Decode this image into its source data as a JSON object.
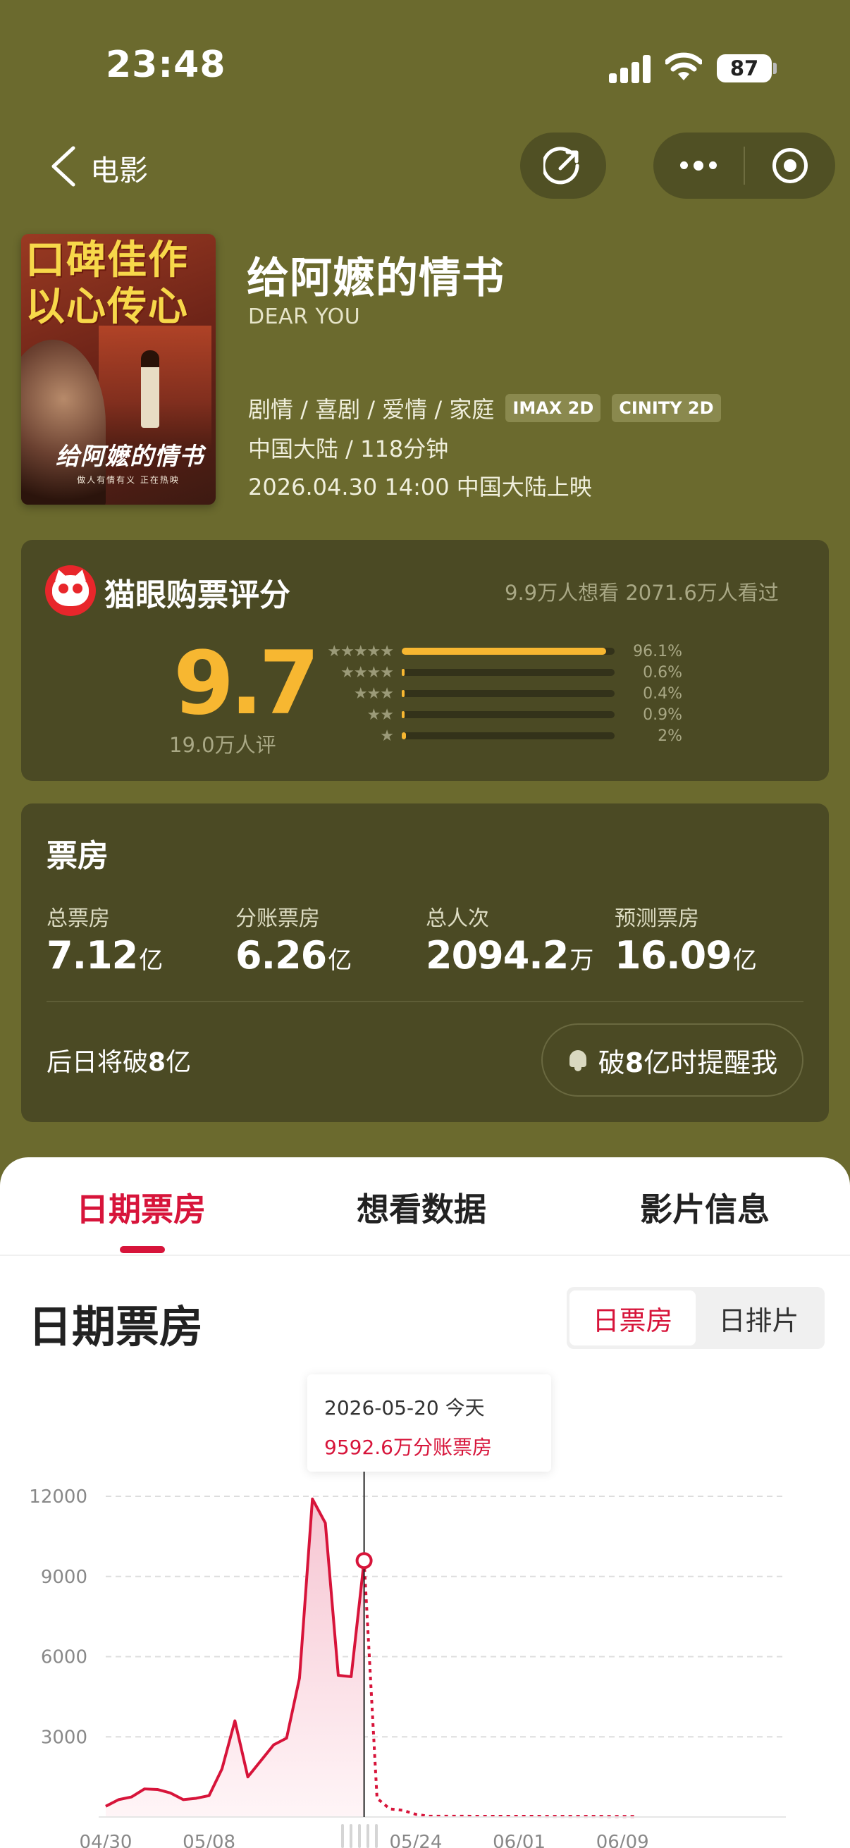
{
  "status": {
    "time": "23:48",
    "battery": "87"
  },
  "nav": {
    "title": "电影"
  },
  "poster": {
    "top_text": "口碑佳作 以心传心",
    "title_text": "给阿嬷的情书",
    "sub_text": "做人有情有义 正在热映"
  },
  "movie": {
    "title": "给阿嬷的情书",
    "english_title": "DEAR YOU",
    "genres": "剧情 / 喜剧 / 爱情 / 家庭",
    "tags": [
      "IMAX 2D",
      "CINITY 2D"
    ],
    "region_duration": "中国大陆 / 118分钟",
    "release": "2026.04.30 14:00 中国大陆上映"
  },
  "rating": {
    "title": "猫眼购票评分",
    "counts": "9.9万人想看  2071.6万人看过",
    "score": "9.7",
    "score_count": "19.0万人评",
    "distribution": [
      {
        "stars": 5,
        "percent": 96.1,
        "label": "96.1%"
      },
      {
        "stars": 4,
        "percent": 0.6,
        "label": "0.6%"
      },
      {
        "stars": 3,
        "percent": 0.4,
        "label": "0.4%"
      },
      {
        "stars": 2,
        "percent": 0.9,
        "label": "0.9%"
      },
      {
        "stars": 1,
        "percent": 2,
        "label": "2%"
      }
    ],
    "colors": {
      "accent": "#f7b731"
    }
  },
  "box_office": {
    "title": "票房",
    "stats": [
      {
        "label": "总票房",
        "value": "7.12",
        "unit": "亿"
      },
      {
        "label": "分账票房",
        "value": "6.26",
        "unit": "亿"
      },
      {
        "label": "总人次",
        "value": "2094.2",
        "unit": "万"
      },
      {
        "label": "预测票房",
        "value": "16.09",
        "unit": "亿"
      }
    ],
    "note_prefix": "后日将破",
    "note_bold": "8",
    "note_suffix": "亿",
    "remind_prefix": "破",
    "remind_bold": "8",
    "remind_suffix": "亿时提醒我"
  },
  "tabs": [
    {
      "label": "日期票房",
      "active": true
    },
    {
      "label": "想看数据",
      "active": false
    },
    {
      "label": "影片信息",
      "active": false
    }
  ],
  "section": {
    "title": "日期票房",
    "toggle": [
      {
        "label": "日票房",
        "on": true
      },
      {
        "label": "日排片",
        "on": false
      }
    ]
  },
  "tooltip": {
    "date": "2026-05-20 今天",
    "value": "9592.6万分账票房"
  },
  "chart_data": {
    "type": "area",
    "x_ticks": [
      "04/30",
      "05/08",
      "05/24",
      "06/01",
      "06/09"
    ],
    "y_ticks": [
      3000,
      6000,
      9000,
      12000
    ],
    "ylim": [
      0,
      12000
    ],
    "start": "2026-04-30",
    "today": "2026-05-20",
    "actual": [
      {
        "date": "2026-04-30",
        "value": 400
      },
      {
        "date": "2026-05-01",
        "value": 650
      },
      {
        "date": "2026-05-02",
        "value": 750
      },
      {
        "date": "2026-05-03",
        "value": 1050
      },
      {
        "date": "2026-05-04",
        "value": 1030
      },
      {
        "date": "2026-05-05",
        "value": 900
      },
      {
        "date": "2026-05-06",
        "value": 650
      },
      {
        "date": "2026-05-07",
        "value": 700
      },
      {
        "date": "2026-05-08",
        "value": 800
      },
      {
        "date": "2026-05-09",
        "value": 1800
      },
      {
        "date": "2026-05-10",
        "value": 3600
      },
      {
        "date": "2026-05-11",
        "value": 1500
      },
      {
        "date": "2026-05-12",
        "value": 2100
      },
      {
        "date": "2026-05-13",
        "value": 2700
      },
      {
        "date": "2026-05-14",
        "value": 2950
      },
      {
        "date": "2026-05-15",
        "value": 5200
      },
      {
        "date": "2026-05-16",
        "value": 11900
      },
      {
        "date": "2026-05-17",
        "value": 11000
      },
      {
        "date": "2026-05-18",
        "value": 5300
      },
      {
        "date": "2026-05-19",
        "value": 5250
      },
      {
        "date": "2026-05-20",
        "value": 9592.6
      }
    ],
    "forecast": [
      {
        "date": "2026-05-20",
        "value": 9592.6
      },
      {
        "date": "2026-05-21",
        "value": 700
      },
      {
        "date": "2026-05-22",
        "value": 300
      },
      {
        "date": "2026-05-23",
        "value": 250
      },
      {
        "date": "2026-05-24",
        "value": 100
      },
      {
        "date": "2026-05-25",
        "value": 30
      },
      {
        "date": "2026-06-10",
        "value": 20
      }
    ],
    "colors": {
      "line": "#d7143a",
      "fill": "#fbe4ea",
      "grid": "#dddddd"
    }
  }
}
